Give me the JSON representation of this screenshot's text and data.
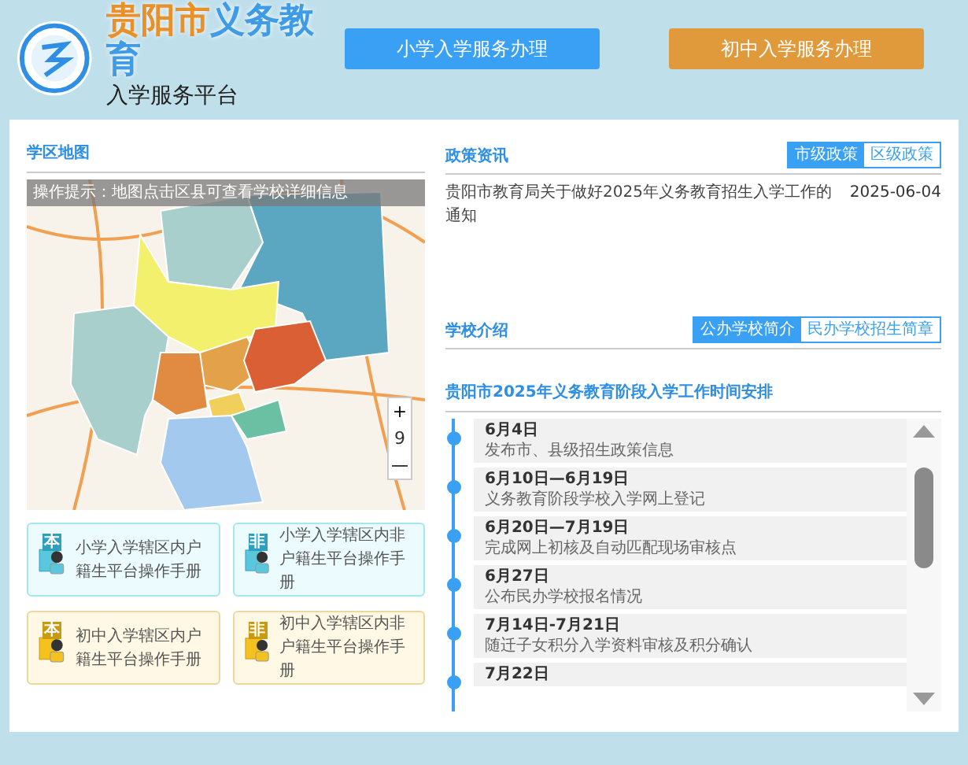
{
  "header": {
    "title_accent": "贵阳市",
    "title_main": "义务教育",
    "subtitle": "入学服务平台",
    "buttons": [
      {
        "label": "小学入学服务办理",
        "kind": "primary"
      },
      {
        "label": "初中入学服务办理",
        "kind": "junior"
      }
    ]
  },
  "map_section": {
    "title": "学区地图",
    "hint": "操作提示：地图点击区县可查看学校详细信息",
    "zoom_in": "+",
    "zoom_level": "9",
    "zoom_out": "—"
  },
  "manuals": [
    {
      "kind": "primary",
      "badge": "本",
      "label": "小学入学辖区内户籍生平台操作手册"
    },
    {
      "kind": "primary",
      "badge": "非",
      "label": "小学入学辖区内非户籍生平台操作手册"
    },
    {
      "kind": "junior",
      "badge": "本",
      "label": "初中入学辖区内户籍生平台操作手册"
    },
    {
      "kind": "junior",
      "badge": "非",
      "label": "初中入学辖区内非户籍生平台操作手册"
    }
  ],
  "policy": {
    "title": "政策资讯",
    "tabs": [
      {
        "label": "市级政策",
        "selected": true
      },
      {
        "label": "区级政策",
        "selected": false
      }
    ],
    "items": [
      {
        "title": "贵阳市教育局关于做好2025年义务教育招生入学工作的通知",
        "date": "2025-06-04"
      }
    ]
  },
  "schools": {
    "title": "学校介绍",
    "tabs": [
      {
        "label": "公办学校简介",
        "selected": true
      },
      {
        "label": "民办学校招生简章",
        "selected": false
      }
    ]
  },
  "schedule": {
    "title": "贵阳市2025年义务教育阶段入学工作时间安排",
    "items": [
      {
        "date": "6月4日",
        "text": "发布市、县级招生政策信息"
      },
      {
        "date": "6月10日—6月19日",
        "text": "义务教育阶段学校入学网上登记"
      },
      {
        "date": "6月20日—7月19日",
        "text": "完成网上初核及自动匹配现场审核点"
      },
      {
        "date": "6月27日",
        "text": "公布民办学校报名情况"
      },
      {
        "date": "7月14日-7月21日",
        "text": "随迁子女积分入学资料审核及积分确认"
      },
      {
        "date": "7月22日"
      }
    ]
  }
}
